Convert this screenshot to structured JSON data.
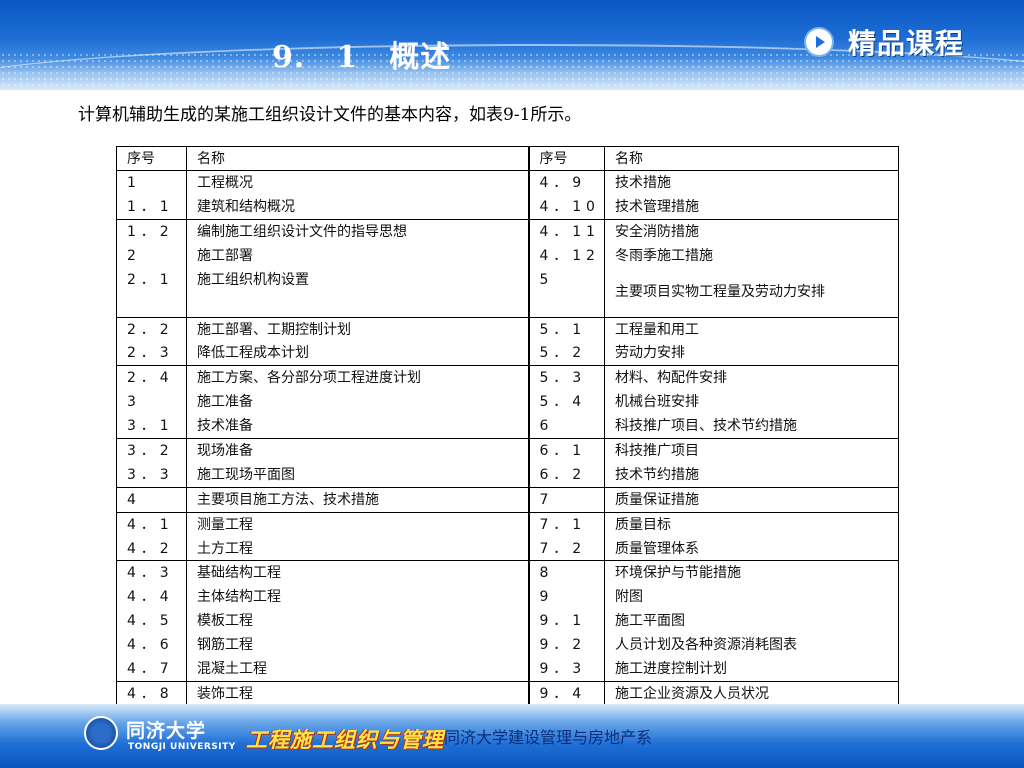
{
  "header": {
    "title": "9.　1　概述",
    "brand": "精品课程"
  },
  "intro": "计算机辅助生成的某施工组织设计文件的基本内容，如表9-1所示。",
  "table": {
    "headers": [
      "序号",
      "名称",
      "序号",
      "名称"
    ],
    "rows": [
      [
        "1",
        "工程概况",
        "4．9",
        "技术措施"
      ],
      [
        "1．1",
        "建筑和结构概况",
        "4．10",
        "技术管理措施"
      ],
      [
        "1．2",
        "编制施工组织设计文件的指导思想",
        "4．11",
        "安全消防措施"
      ],
      [
        "2",
        "施工部署",
        "4．12",
        "冬雨季施工措施"
      ],
      [
        "2．1",
        "施工组织机构设置",
        "5",
        "主要项目实物工程量及劳动力安排"
      ],
      [
        "2．2",
        "施工部署、工期控制计划",
        "5．1",
        "工程量和用工"
      ],
      [
        "2．3",
        "降低工程成本计划",
        "5．2",
        "劳动力安排"
      ],
      [
        "2．4",
        "施工方案、各分部分项工程进度计划",
        "5．3",
        "材料、构配件安排"
      ],
      [
        "3",
        "施工准备",
        "5．4",
        "机械台班安排"
      ],
      [
        "3．1",
        "技术准备",
        "6",
        "科技推广项目、技术节约措施"
      ],
      [
        "3．2",
        "现场准备",
        "6．1",
        "科技推广项目"
      ],
      [
        "3．3",
        "施工现场平面图",
        "6．2",
        "技术节约措施"
      ],
      [
        "4",
        "主要项目施工方法、技术措施",
        "7",
        "质量保证措施"
      ],
      [
        "4．1",
        "测量工程",
        "7．1",
        "质量目标"
      ],
      [
        "4．2",
        "土方工程",
        "7．2",
        "质量管理体系"
      ],
      [
        "4．3",
        "基础结构工程",
        "8",
        "环境保护与节能措施"
      ],
      [
        "4．4",
        "主体结构工程",
        "9",
        "附图"
      ],
      [
        "4．5",
        "模板工程",
        "9．1",
        "施工平面图"
      ],
      [
        "4．6",
        "钢筋工程",
        "9．2",
        "人员计划及各种资源消耗图表"
      ],
      [
        "4．7",
        "混凝土工程",
        "9．3",
        "施工进度控制计划"
      ],
      [
        "4．8",
        "装饰工程",
        "9．4",
        "施工企业资源及人员状况"
      ]
    ]
  },
  "footer": {
    "university": "同济大学",
    "university_en": "TONGJI UNIVERSITY",
    "course": "工程施工组织与管理",
    "department": "同济大学建设管理与房地产系"
  }
}
